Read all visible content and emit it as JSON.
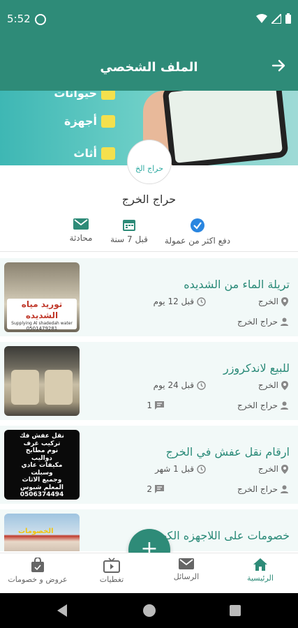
{
  "status_bar": {
    "time": "5:52"
  },
  "app_bar": {
    "title": "الملف الشخصي"
  },
  "banner": {
    "rows": [
      "حيوانات",
      "أجهزة",
      "أثاث"
    ]
  },
  "avatar": {
    "text": "حراج الخ"
  },
  "profile": {
    "name": "حراج الخرج"
  },
  "stats": {
    "commission": "دفع اكثر من عمولة",
    "joined": "قبل 7 سنة",
    "chat": "محادثة"
  },
  "listings": [
    {
      "title": "تريلة الماء من الشديده",
      "city": "الخرج",
      "time": "قبل 12 يوم",
      "seller": "حراج الخرج",
      "comments": ""
    },
    {
      "title": "للبيع لاندكروزر",
      "city": "الخرج",
      "time": "قبل 24 يوم",
      "seller": "حراج الخرج",
      "comments": "1"
    },
    {
      "title": "ارقام نقل عفش في الخرج",
      "city": "الخرج",
      "time": "قبل 1 شهر",
      "seller": "حراج الخرج",
      "comments": "2"
    },
    {
      "title": "خصومات على اللاجهزه الكهربا"
    }
  ],
  "thumbs": {
    "water_sign": "توريد مياه الشديده",
    "water_sub": "Supplying Al shadedah water",
    "water_phone": "0501479281",
    "moving_lines": [
      "نقل عفش فك",
      "تركيب غرف",
      "نوم مطابخ",
      "دواليب",
      "مكيفات عادي",
      "وسبلت",
      "وجميع الاثاث",
      "المعلم شبوس",
      "0506374494"
    ],
    "store_sign": "الخصومات"
  },
  "fab": {
    "label": "+"
  },
  "bottom_nav": {
    "home": "الرئيسية",
    "messages": "الرسائل",
    "coverage": "تغطيات",
    "offers": "عروض و خصومات"
  },
  "colors": {
    "primary": "#2e8b78",
    "card_bg": "#f2f9f8",
    "verified": "#2a86e0"
  }
}
